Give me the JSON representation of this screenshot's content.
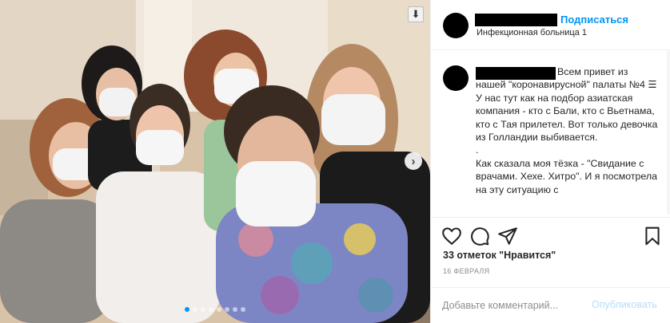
{
  "post": {
    "header": {
      "follow_label": "Подписаться",
      "location": "Инфекционная больница 1"
    },
    "caption": {
      "first_line": "Всем привет из",
      "paragraph1": "нашей \"коронавирусной\" палаты №4 ☰ У нас тут как на подбор азиатская компания - кто с Бали, кто с Вьетнама, кто с Тая прилетел. Вот только девочка из Голландии выбивается.",
      "separator": ".",
      "paragraph2": "Как сказала моя тёзка - \"Свидание с врачами. Хехе. Хитро\". И я посмотрела на эту ситуацию с"
    },
    "likes_text": "33 отметок \"Нравится\"",
    "date": "16 ФЕВРАЛЯ",
    "comment_placeholder": "Добавьте комментарий...",
    "publish_label": "Опубликовать",
    "carousel": {
      "total": 8,
      "active_index": 0
    },
    "icons": {
      "download": "download-icon",
      "next": "chevron-right-icon",
      "like": "heart-icon",
      "comment": "comment-icon",
      "share": "share-icon",
      "save": "bookmark-icon"
    },
    "colors": {
      "accent": "#0095f6",
      "publish_disabled": "#b2dffc",
      "muted": "#8e8e8e"
    }
  }
}
